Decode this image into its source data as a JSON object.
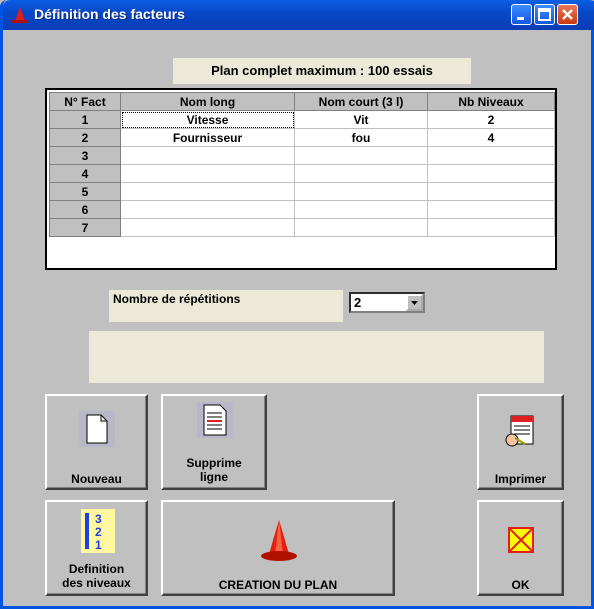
{
  "window": {
    "title": "Définition des facteurs"
  },
  "plan_label": "Plan complet maximum : 100 essais",
  "grid": {
    "headers": [
      "N° Fact",
      "Nom long",
      "Nom court (3 l)",
      "Nb Niveaux"
    ],
    "rows": [
      [
        "1",
        "Vitesse",
        "Vit",
        "2"
      ],
      [
        "2",
        "Fournisseur",
        "fou",
        "4"
      ],
      [
        "3",
        "",
        "",
        ""
      ],
      [
        "4",
        "",
        "",
        ""
      ],
      [
        "5",
        "",
        "",
        ""
      ],
      [
        "6",
        "",
        "",
        ""
      ],
      [
        "7",
        "",
        "",
        ""
      ]
    ]
  },
  "repetitions": {
    "label": "Nombre de répétitions",
    "value": "2"
  },
  "buttons": {
    "nouveau": "Nouveau",
    "supprime_1": "Supprime",
    "supprime_2": "ligne",
    "imprimer": "Imprimer",
    "def_1": "Definition",
    "def_2": "des niveaux",
    "creation": "CREATION DU PLAN",
    "ok": "OK"
  },
  "icons": {
    "title": "cone-icon",
    "nouveau": "blank-document-icon",
    "supprime": "lined-document-icon",
    "imprimer": "print-preview-icon",
    "definition": "numbered-levels-icon",
    "creation": "cone-icon",
    "ok": "x-box-icon"
  },
  "colors": {
    "titlebar": "#0848c8",
    "cone": "#e02010"
  }
}
